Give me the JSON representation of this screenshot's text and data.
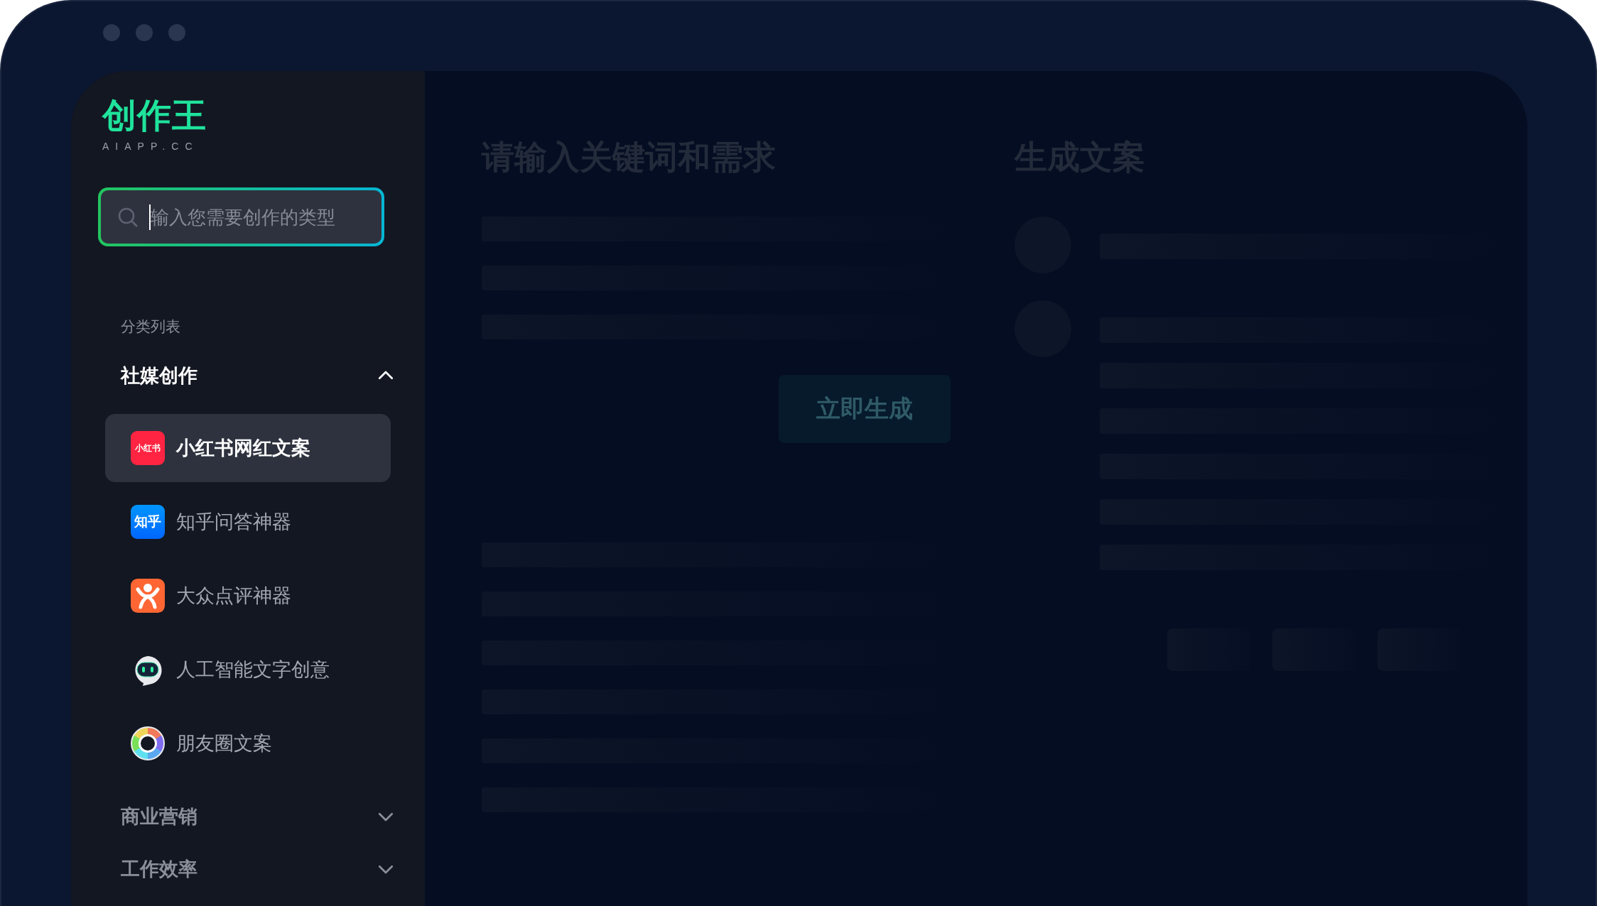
{
  "logo": {
    "mark": "创作王",
    "domain": "AIAPP.CC"
  },
  "search": {
    "placeholder": "输入您需要创作的类型"
  },
  "sidebar": {
    "heading": "分类列表",
    "groups": [
      {
        "label": "社媒创作",
        "expanded": true,
        "items": [
          {
            "label": "小红书网红文案",
            "kind": "xiaohongshu",
            "icon_text": "小红书",
            "selected": true
          },
          {
            "label": "知乎问答神器",
            "kind": "zhihu",
            "icon_text": "知乎",
            "selected": false
          },
          {
            "label": "大众点评神器",
            "kind": "dianping",
            "selected": false
          },
          {
            "label": "人工智能文字创意",
            "kind": "robot",
            "selected": false
          },
          {
            "label": "朋友圈文案",
            "kind": "moments",
            "selected": false
          }
        ]
      },
      {
        "label": "商业营销",
        "expanded": false
      },
      {
        "label": "工作效率",
        "expanded": false
      }
    ]
  },
  "input_panel": {
    "title": "请输入关键词和需求",
    "button": "立即生成"
  },
  "output_panel": {
    "title": "生成文案"
  }
}
